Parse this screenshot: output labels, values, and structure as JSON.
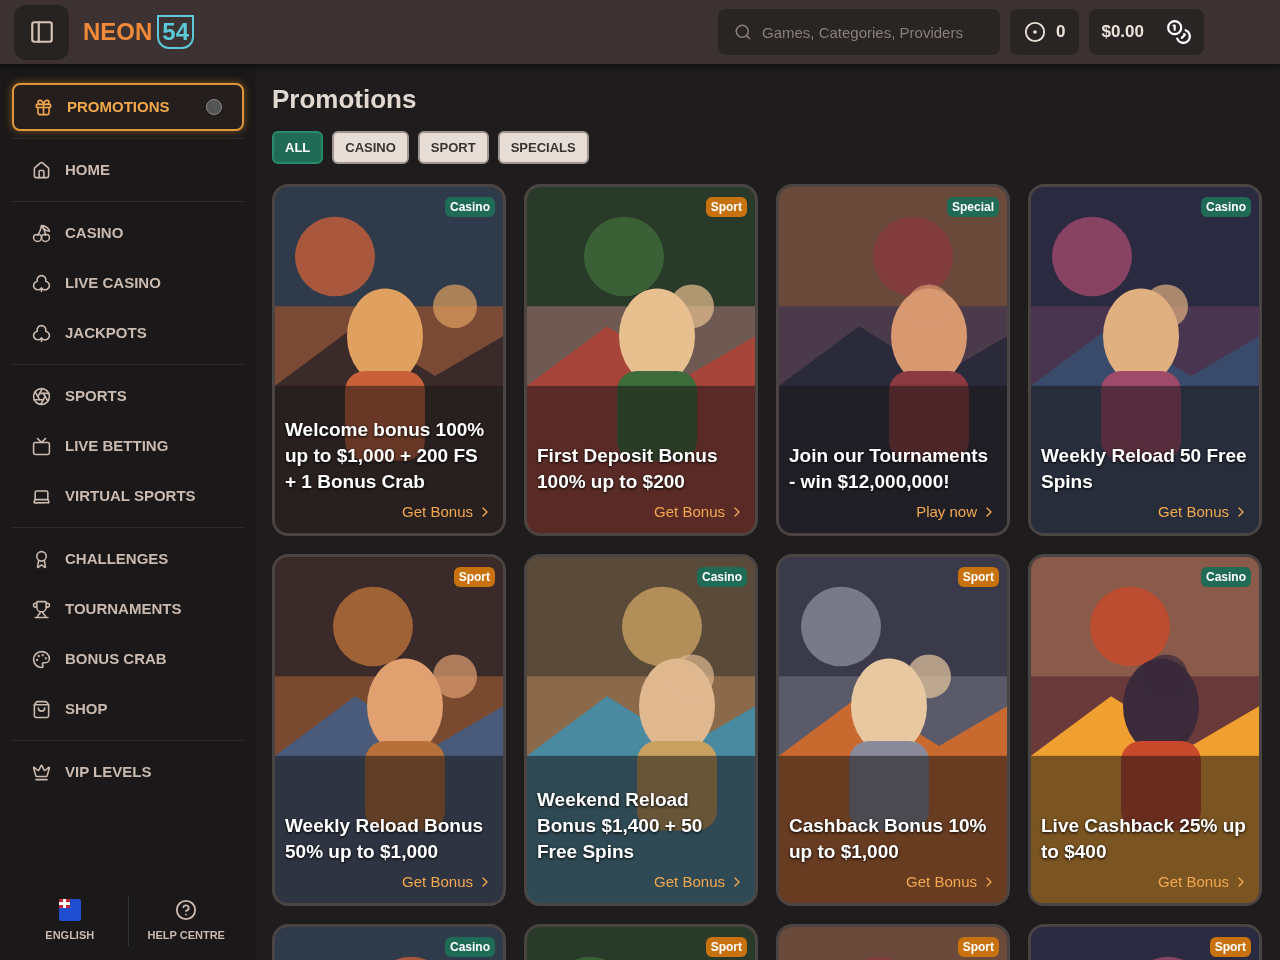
{
  "header": {
    "logo": {
      "word": "NEON",
      "number": "54"
    },
    "search": {
      "placeholder": "Games, Categories, Providers"
    },
    "coins": "0",
    "balance": "$0.00"
  },
  "sidebar": {
    "groups": [
      [
        {
          "label": "PROMOTIONS",
          "selected": true
        }
      ],
      [
        {
          "label": "HOME",
          "selected": false
        }
      ],
      [
        {
          "label": "CASINO",
          "selected": false
        },
        {
          "label": "LIVE CASINO",
          "selected": false
        },
        {
          "label": "JACKPOTS",
          "selected": false
        }
      ],
      [
        {
          "label": "SPORTS",
          "selected": false
        },
        {
          "label": "LIVE BETTING",
          "selected": false
        },
        {
          "label": "VIRTUAL SPORTS",
          "selected": false
        }
      ],
      [
        {
          "label": "CHALLENGES",
          "selected": false
        },
        {
          "label": "TOURNAMENTS",
          "selected": false
        },
        {
          "label": "BONUS CRAB",
          "selected": false
        },
        {
          "label": "SHOP",
          "selected": false
        }
      ],
      [
        {
          "label": "VIP LEVELS",
          "selected": false
        }
      ]
    ],
    "footer": {
      "language": "ENGLISH",
      "help": "HELP CENTRE"
    }
  },
  "page": {
    "title": "Promotions",
    "filters": [
      {
        "label": "ALL",
        "selected": true
      },
      {
        "label": "CASINO",
        "selected": false
      },
      {
        "label": "SPORT",
        "selected": false
      },
      {
        "label": "SPECIALS",
        "selected": false
      }
    ],
    "cards": [
      {
        "tag": "Casino",
        "color": "#1f6b55",
        "title": "Welcome bonus 100% up to $1,000 + 200 FS + 1 Bonus Crab",
        "action": "Get Bonus"
      },
      {
        "tag": "Sport",
        "color": "#c8720f",
        "title": "First Deposit Bonus 100% up to $200",
        "action": "Get Bonus"
      },
      {
        "tag": "Special",
        "color": "#1f6b55",
        "title": "Join our Tournaments - win $12,000,000!",
        "action": "Play now"
      },
      {
        "tag": "Casino",
        "color": "#1f6b55",
        "title": "Weekly Reload 50 Free Spins",
        "action": "Get Bonus"
      },
      {
        "tag": "Sport",
        "color": "#c8720f",
        "title": "Weekly Reload Bonus 50% up to $1,000",
        "action": "Get Bonus"
      },
      {
        "tag": "Casino",
        "color": "#1f6b55",
        "title": "Weekend Reload Bonus $1,400 + 50 Free Spins",
        "action": "Get Bonus"
      },
      {
        "tag": "Sport",
        "color": "#c8720f",
        "title": "Cashback Bonus 10% up to $1,000",
        "action": "Get Bonus"
      },
      {
        "tag": "Casino",
        "color": "#1f6b55",
        "title": "Live Cashback 25% up to $400",
        "action": "Get Bonus"
      },
      {
        "tag": "Casino",
        "color": "#1f6b55"
      },
      {
        "tag": "Sport",
        "color": "#c8720f"
      },
      {
        "tag": "Sport",
        "color": "#c8720f"
      },
      {
        "tag": "Sport",
        "color": "#c8720f"
      }
    ]
  }
}
